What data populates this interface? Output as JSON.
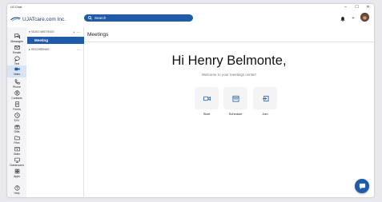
{
  "window": {
    "title": "UCChat",
    "minimize": "–",
    "maximize": "☐",
    "close": "✕"
  },
  "topbar": {
    "logo_text": "UJATcare.com Inc.",
    "search_label": "Search",
    "notification_icon": "bell-icon",
    "add_icon": "plus-icon",
    "accent": "#1e5ba8"
  },
  "sidebar": {
    "items": [
      {
        "label": "Messages",
        "icon": "chat-bubbles-icon"
      },
      {
        "label": "Emails",
        "icon": "envelope-icon"
      },
      {
        "label": "Text",
        "icon": "speech-bubble-icon"
      },
      {
        "label": "Video",
        "icon": "video-camera-icon",
        "active": true
      },
      {
        "label": "Phone",
        "icon": "phone-icon"
      },
      {
        "label": "Contacts",
        "icon": "contacts-icon"
      },
      {
        "label": "Forms",
        "icon": "form-icon"
      },
      {
        "label": "EVV",
        "icon": "clock-icon"
      },
      {
        "label": "Gifts",
        "icon": "gift-icon"
      },
      {
        "label": "Files",
        "icon": "folder-icon"
      },
      {
        "label": "Video",
        "icon": "video-library-icon"
      },
      {
        "label": "Classrooms",
        "icon": "classroom-icon"
      },
      {
        "label": "Apps",
        "icon": "apps-icon"
      },
      {
        "label": "Help",
        "icon": "help-icon"
      }
    ]
  },
  "nav": {
    "video_meetings_header": "VIDEO MEETINGS",
    "add": "+",
    "more": "⋯",
    "meeting_item": "Meeting",
    "recordings_header": "RECORDINGS"
  },
  "main": {
    "title": "Meetings",
    "greeting": "Hi Henry Belmonte,",
    "subtitle": "Welcome to your meetings center!",
    "actions": [
      {
        "label": "Start",
        "icon": "video-camera-icon"
      },
      {
        "label": "Schedule",
        "icon": "calendar-icon"
      },
      {
        "label": "Join",
        "icon": "join-icon"
      }
    ]
  },
  "chat_fab": {
    "icon": "chat-icon"
  }
}
